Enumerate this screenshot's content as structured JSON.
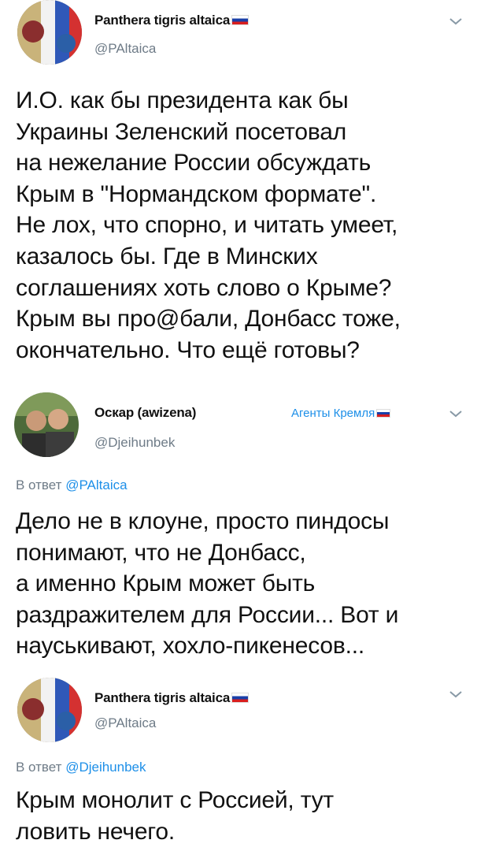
{
  "tweets": [
    {
      "name": "Panthera tigris altaica",
      "handle": "@PAltaica",
      "reply_prefix": "",
      "reply_mention": "",
      "badge": "",
      "text": "И.О. как бы президента как бы\nУкраины Зеленский посетовал\nна нежелание России обсуждать\nКрым в \"Нормандском формате\".\nНе лох, что спорно, и читать умеет,\nказалось бы. Где в Минских\nсоглашениях хоть слово о Крыме?\nКрым вы про@бали, Донбасс тоже,\nокончательно. Что ещё готовы?"
    },
    {
      "name": "Оскар (awizena)",
      "handle": "@Djeihunbek",
      "reply_prefix": "В ответ",
      "reply_mention": "@PAltaica",
      "badge": "Агенты Кремля",
      "text": "Дело не в клоуне, просто пиндосы\nпонимают, что не Донбасс,\nа именно Крым может быть\nраздражителем для России... Вот и\nнауськивают, хохло-пикенесов..."
    },
    {
      "name": "Panthera tigris altaica",
      "handle": "@PAltaica",
      "reply_prefix": "В ответ",
      "reply_mention": "@Djeihunbek",
      "badge": "",
      "text": "Крым монолит с Россией, тут\nловить нечего."
    }
  ],
  "colors": {
    "link": "#1d8fe8",
    "muted": "#6e7b87",
    "text": "#111111"
  },
  "icons": [
    "avatar",
    "flag-icon",
    "chevron-down-icon"
  ]
}
